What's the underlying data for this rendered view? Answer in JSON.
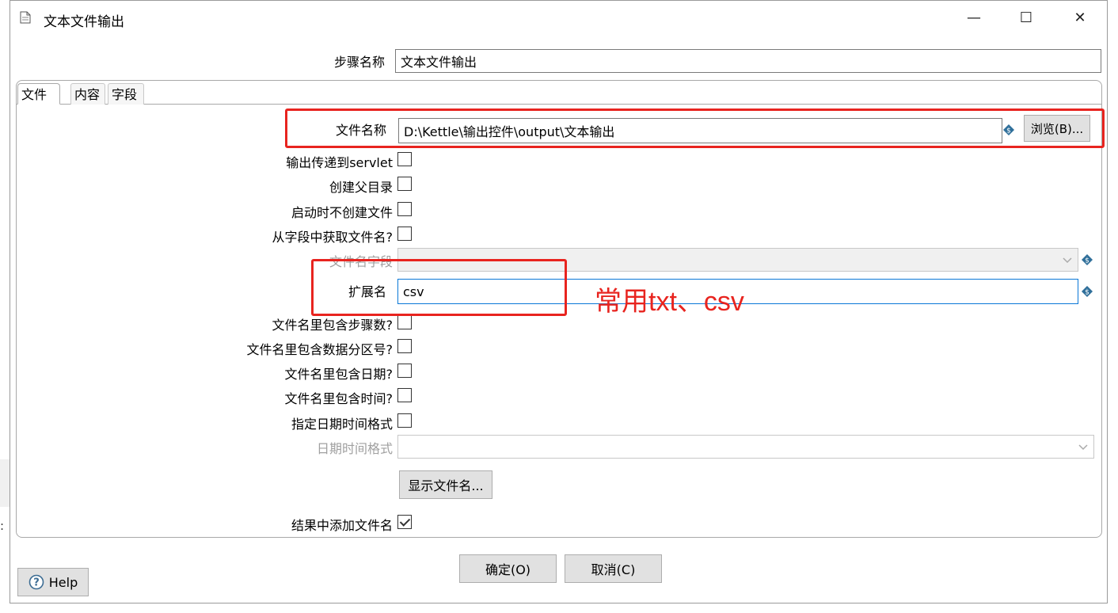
{
  "window": {
    "title": "文本文件输出",
    "minimize_glyph": "—",
    "maximize_glyph": "☐",
    "close_glyph": "✕"
  },
  "step": {
    "label": "步骤名称",
    "value": "文本文件输出"
  },
  "tabs": [
    {
      "label": "文件",
      "active": true
    },
    {
      "label": "内容",
      "active": false
    },
    {
      "label": "字段",
      "active": false
    }
  ],
  "file_tab": {
    "filename_label": "文件名称",
    "filename_value": "D:\\Kettle\\输出控件\\output\\文本输出",
    "browse_label": "浏览(B)...",
    "servlet_label": "输出传递到servlet",
    "servlet_checked": false,
    "create_parent_label": "创建父目录",
    "create_parent_checked": false,
    "no_create_label": "启动时不创建文件",
    "no_create_checked": false,
    "from_field_label": "从字段中获取文件名?",
    "from_field_checked": false,
    "filename_field_label": "文件名字段",
    "extension_label": "扩展名",
    "extension_value": "csv",
    "include_stepnr_label": "文件名里包含步骤数?",
    "include_stepnr_checked": false,
    "include_partnr_label": "文件名里包含数据分区号?",
    "include_partnr_checked": false,
    "include_date_label": "文件名里包含日期?",
    "include_date_checked": false,
    "include_time_label": "文件名里包含时间?",
    "include_time_checked": false,
    "specify_format_label": "指定日期时间格式",
    "specify_format_checked": false,
    "datetime_format_label": "日期时间格式",
    "show_filename_label": "显示文件名...",
    "add_to_result_label": "结果中添加文件名",
    "add_to_result_checked": true
  },
  "footer": {
    "ok_label": "确定(O)",
    "cancel_label": "取消(C)",
    "help_label": "Help"
  },
  "annotation": {
    "text": "常用txt、csv",
    "color": "#e8241f"
  },
  "colors": {
    "accent_focus": "#0a78d7",
    "variable_icon": "#2f6f9a"
  }
}
